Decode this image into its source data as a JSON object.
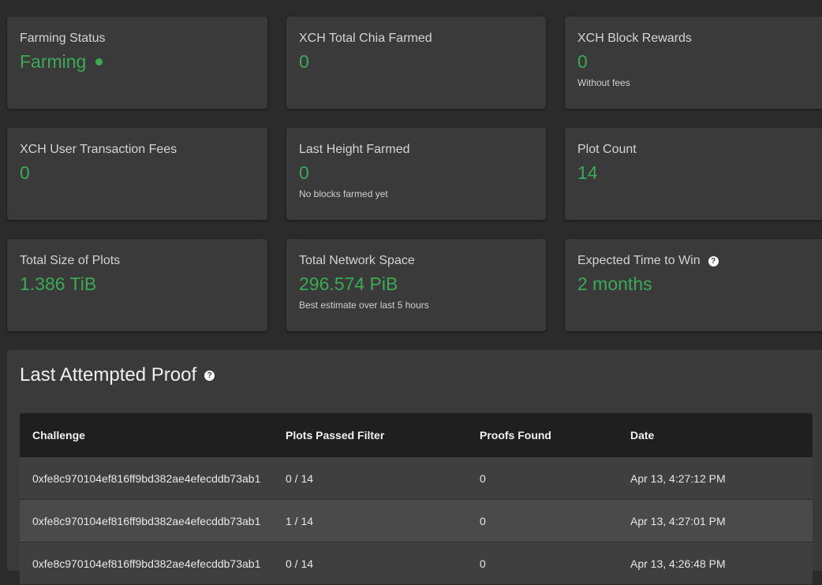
{
  "cards": [
    {
      "title": "Farming Status",
      "value": "Farming",
      "desc": ""
    },
    {
      "title": "XCH Total Chia Farmed",
      "value": "0",
      "desc": ""
    },
    {
      "title": "XCH Block Rewards",
      "value": "0",
      "desc": "Without fees"
    },
    {
      "title": "XCH User Transaction Fees",
      "value": "0",
      "desc": ""
    },
    {
      "title": "Last Height Farmed",
      "value": "0",
      "desc": "No blocks farmed yet"
    },
    {
      "title": "Plot Count",
      "value": "14",
      "desc": ""
    },
    {
      "title": "Total Size of Plots",
      "value": "1.386 TiB",
      "desc": ""
    },
    {
      "title": "Total Network Space",
      "value": "296.574 PiB",
      "desc": "Best estimate over last 5 hours"
    },
    {
      "title": "Expected Time to Win",
      "value": "2 months",
      "desc": ""
    }
  ],
  "proof": {
    "title": "Last Attempted Proof",
    "help_glyph": "?",
    "columns": [
      "Challenge",
      "Plots Passed Filter",
      "Proofs Found",
      "Date"
    ],
    "rows": [
      [
        "0xfe8c970104ef816ff9bd382ae4efecddb73ab1",
        "0 / 14",
        "0",
        "Apr 13, 4:27:12 PM"
      ],
      [
        "0xfe8c970104ef816ff9bd382ae4efecddb73ab1",
        "1 / 14",
        "0",
        "Apr 13, 4:27:01 PM"
      ],
      [
        "0xfe8c970104ef816ff9bd382ae4efecddb73ab1",
        "0 / 14",
        "0",
        "Apr 13, 4:26:48 PM"
      ]
    ]
  },
  "help_glyph": "?",
  "colors": {
    "accent_green": "#3aaa55",
    "card_bg": "#3a3a3a",
    "page_bg": "#2b2b2b"
  },
  "icons": {
    "status": "status-dot-icon",
    "help": "help-circle-icon"
  }
}
